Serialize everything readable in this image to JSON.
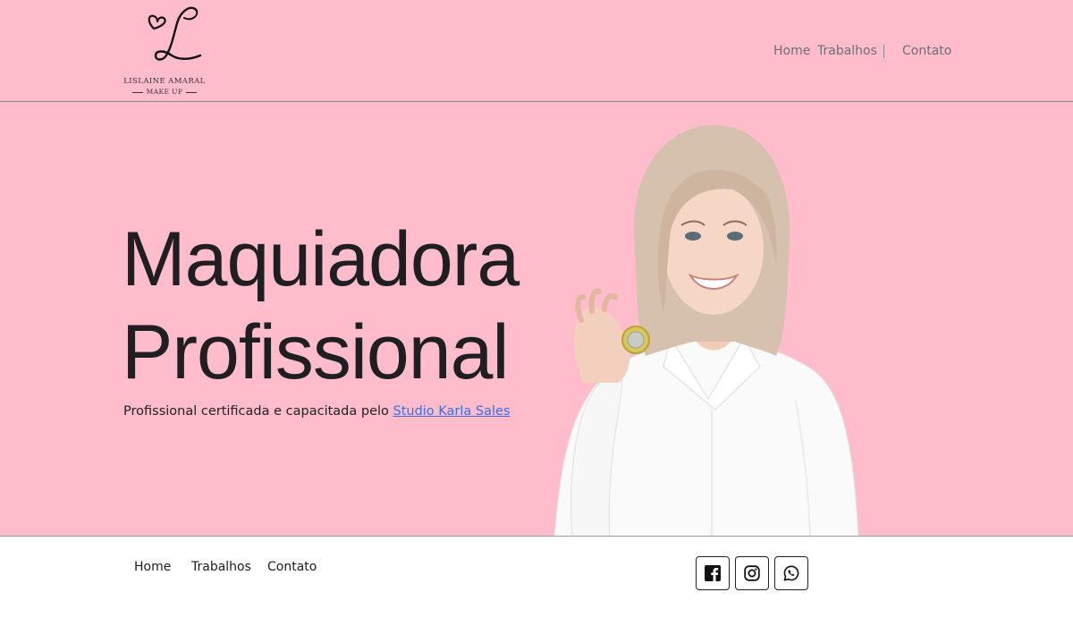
{
  "brand": {
    "name": "LISLAINE AMARAL",
    "tagline": "MAKE UP",
    "monogram_icon": "heart-l-monogram-icon"
  },
  "header": {
    "nav": {
      "home": "Home",
      "work": "Trabalhos",
      "contact": "Contato"
    }
  },
  "hero": {
    "title_line1": "Maquiadora",
    "title_line2": "Profissional",
    "subtitle_prefix": "Profissional certificada e capacitada pelo ",
    "subtitle_link": "Studio Karla Sales",
    "image_alt": "smiling-woman-holding-coin"
  },
  "footer": {
    "nav": {
      "home": "Home",
      "work": "Trabalhos",
      "contact": "Contato"
    },
    "social": [
      {
        "name": "facebook",
        "icon": "facebook-icon"
      },
      {
        "name": "instagram",
        "icon": "instagram-icon"
      },
      {
        "name": "whatsapp",
        "icon": "whatsapp-icon"
      }
    ]
  },
  "colors": {
    "background_pink": "#ffbccb",
    "link_blue": "#3b6fe0",
    "text_dark": "#1f1f22"
  }
}
